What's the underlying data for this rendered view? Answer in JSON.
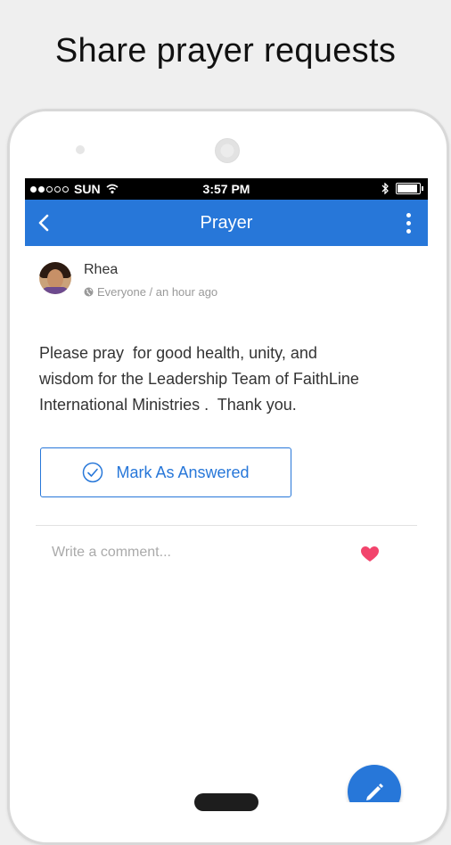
{
  "headline": "Share prayer requests",
  "status_bar": {
    "carrier": "SUN",
    "time": "3:57 PM",
    "signal_bars_filled": 2,
    "signal_bars_total": 5
  },
  "app_bar": {
    "title": "Prayer",
    "back_icon": "back-chevron-icon",
    "menu_icon": "overflow-menu-icon",
    "color": "#2777d9"
  },
  "post": {
    "author": "Rhea",
    "audience": "Everyone / an hour ago",
    "audience_icon": "globe-icon",
    "body": "Please pray  for good health, unity, and\nwisdom for the Leadership Team of FaithLine\nInternational Ministries .  Thank you."
  },
  "answer_button": {
    "label": "Mark As Answered",
    "icon": "check-circle-icon"
  },
  "comment": {
    "placeholder": "Write a comment...",
    "like_icon": "heart-icon",
    "like_color": "#f2446c"
  },
  "fab": {
    "icon": "pencil-icon"
  }
}
